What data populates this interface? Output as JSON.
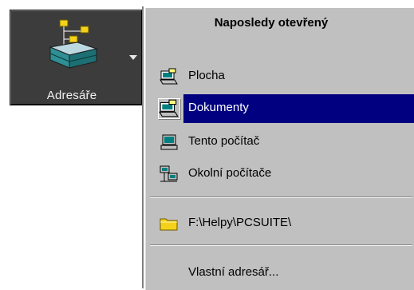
{
  "toolbar": {
    "button_label": "Adresáře",
    "button_icon": "directories-icon",
    "arrow_icon": "dropdown-arrow-icon"
  },
  "menu": {
    "header": "Naposledy otevřený",
    "items": [
      {
        "label": "Plocha",
        "icon": "desktop-icon"
      },
      {
        "label": "Dokumenty",
        "icon": "documents-icon",
        "selected": true
      },
      {
        "label": "Tento počítač",
        "icon": "computer-icon"
      },
      {
        "label": "Okolní počítače",
        "icon": "network-icon"
      }
    ],
    "recent": [
      {
        "label": "F:\\Helpy\\PCSUITE\\",
        "icon": "folder-icon"
      }
    ],
    "custom": "Vlastní adresář..."
  },
  "colors": {
    "menu_bg": "#c0c0c0",
    "highlight": "#000080",
    "button_bg": "#3c3c3c"
  }
}
